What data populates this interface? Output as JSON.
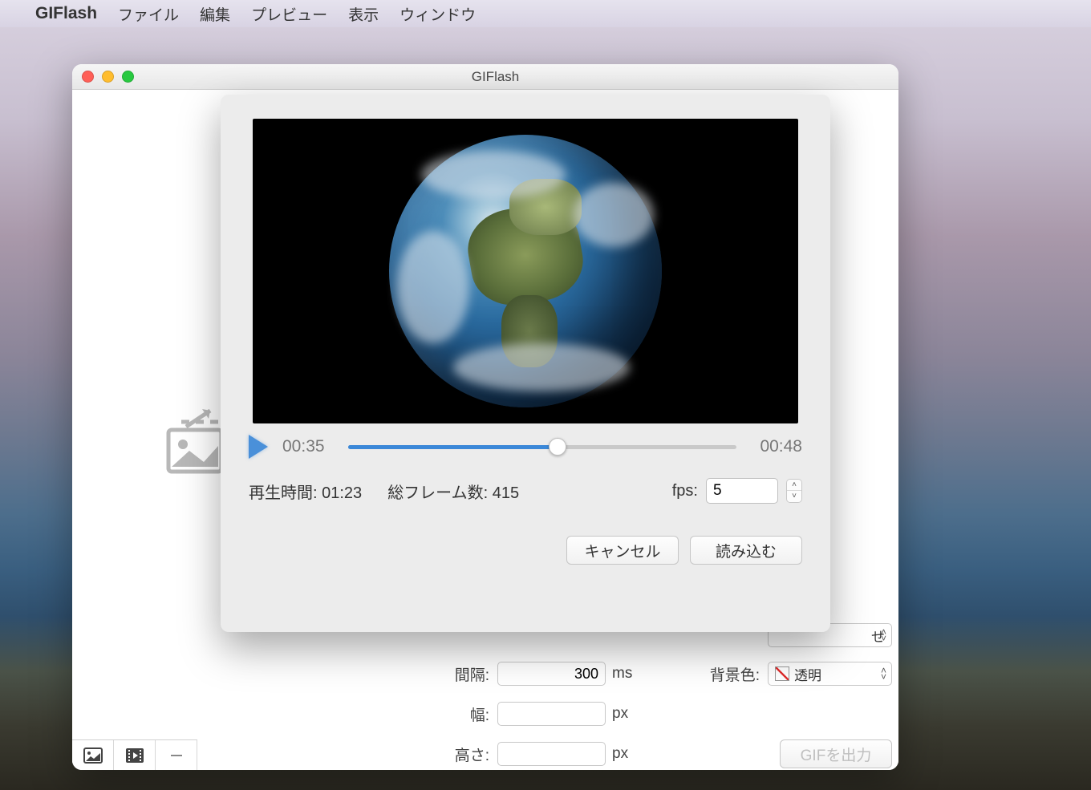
{
  "menubar": {
    "app": "GIFlash",
    "items": [
      "ファイル",
      "編集",
      "プレビュー",
      "表示",
      "ウィンドウ"
    ]
  },
  "window": {
    "title": "GIFlash"
  },
  "settings": {
    "interval_label": "間隔:",
    "interval_value": "300",
    "interval_unit": "ms",
    "bgcolor_label": "背景色:",
    "bgcolor_value": "透明",
    "width_label": "幅:",
    "width_value": "",
    "width_unit": "px",
    "height_label": "高さ:",
    "height_value": "",
    "height_unit": "px",
    "hidden_combo_suffix": "せ",
    "export_label": "GIFを出力"
  },
  "sheet": {
    "time_start": "00:35",
    "time_end": "00:48",
    "duration_label": "再生時間:",
    "duration_value": "01:23",
    "frames_label": "総フレーム数:",
    "frames_value": "415",
    "fps_label": "fps:",
    "fps_value": "5",
    "cancel": "キャンセル",
    "load": "読み込む"
  }
}
